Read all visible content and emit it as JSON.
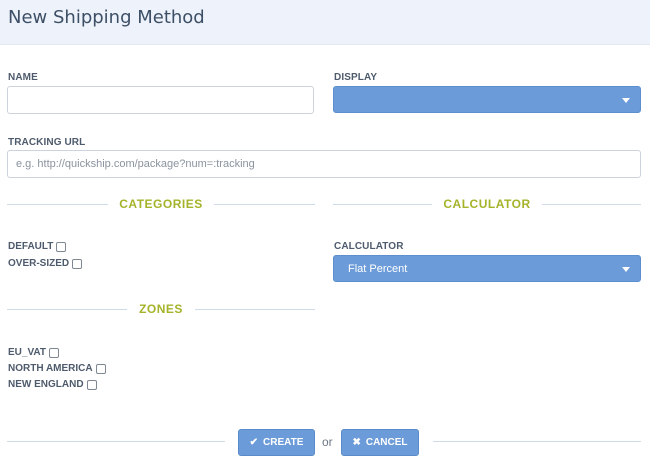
{
  "header": {
    "title": "New Shipping Method"
  },
  "form": {
    "name": {
      "label": "NAME",
      "value": "",
      "placeholder": ""
    },
    "display": {
      "label": "DISPLAY",
      "value": ""
    },
    "tracking_url": {
      "label": "TRACKING URL",
      "value": "",
      "placeholder": "e.g. http://quickship.com/package?num=:tracking"
    }
  },
  "categories": {
    "title": "CATEGORIES",
    "items": [
      {
        "label": "DEFAULT",
        "checked": false
      },
      {
        "label": "OVER-SIZED",
        "checked": false
      }
    ]
  },
  "calculator": {
    "title": "CALCULATOR",
    "label": "CALCULATOR",
    "selected": "Flat Percent"
  },
  "zones": {
    "title": "ZONES",
    "items": [
      {
        "label": "EU_VAT",
        "checked": false
      },
      {
        "label": "NORTH AMERICA",
        "checked": false
      },
      {
        "label": "NEW ENGLAND",
        "checked": false
      }
    ]
  },
  "actions": {
    "create_label": "CREATE",
    "or_text": "or",
    "cancel_label": "CANCEL"
  },
  "colors": {
    "accent": "#6b9bd8",
    "section_title": "#a5b32a",
    "header_bg": "#eef3fb"
  },
  "icons": {
    "create": "check-icon",
    "cancel": "x-icon",
    "select": "caret-down-icon"
  }
}
